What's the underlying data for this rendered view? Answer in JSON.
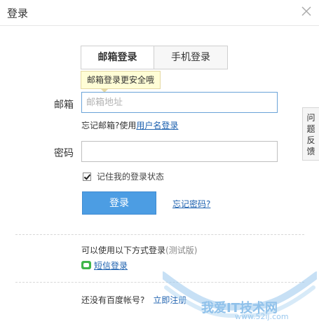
{
  "header": {
    "title": "登录",
    "close_icon": "close-icon"
  },
  "tabs": [
    {
      "label": "邮箱登录",
      "active": true
    },
    {
      "label": "手机登录",
      "active": false
    }
  ],
  "tooltip": {
    "text": "邮箱登录更安全哦"
  },
  "form": {
    "email_label": "邮箱",
    "email_placeholder": "邮箱地址",
    "email_value": "",
    "forgot_email_prefix": "忘记邮箱?使用",
    "forgot_email_link": "用户名登录",
    "password_label": "密码",
    "password_value": "",
    "remember_label": "记住我的登录状态",
    "remember_checked": true,
    "login_button": "登录",
    "forgot_password": "忘记密码?"
  },
  "other_login": {
    "label": "可以使用以下方式登录",
    "note": "(测试版)",
    "sms_label": "短信登录",
    "sms_icon": "message-icon"
  },
  "signup": {
    "question": "还没有百度帐号?",
    "register_link": "立即注册"
  },
  "feedback": {
    "label": "问题反馈"
  },
  "watermark": {
    "text": "我爱IT技术网",
    "url": "www.52ij.com",
    "colors": {
      "accent": "#8fc1ea"
    }
  },
  "colors": {
    "primary_button": "#4c9de3",
    "link": "#2063b0",
    "tooltip_bg": "#fffdd6"
  }
}
